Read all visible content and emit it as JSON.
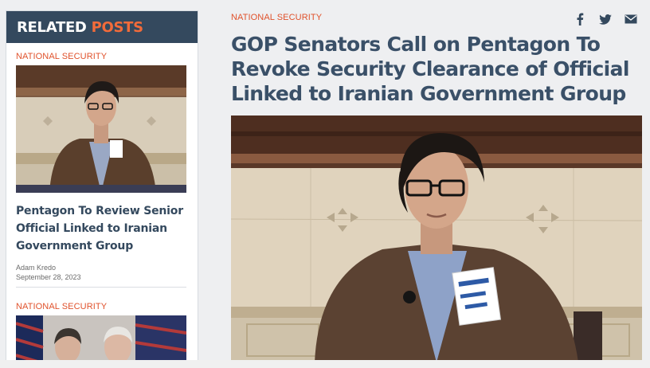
{
  "sidebar": {
    "heading_part1": "RELATED",
    "heading_part2": "POSTS",
    "posts": [
      {
        "category": "NATIONAL SECURITY",
        "title_lines": [
          "Pentagon To Review Senior",
          "Official Linked to Iranian",
          "Government Group"
        ],
        "author": "Adam Kredo",
        "date": "September 28, 2023"
      },
      {
        "category": "NATIONAL SECURITY"
      }
    ]
  },
  "article": {
    "category": "NATIONAL SECURITY",
    "headline_lines": [
      "GOP Senators Call on Pentagon To",
      "Revoke Security Clearance of Official",
      "Linked to Iranian Government Group"
    ],
    "share_icons": [
      "facebook-icon",
      "twitter-icon",
      "email-icon"
    ]
  },
  "colors": {
    "accent": "#e0522c",
    "navy": "#34495e",
    "headline": "#3a5068"
  }
}
